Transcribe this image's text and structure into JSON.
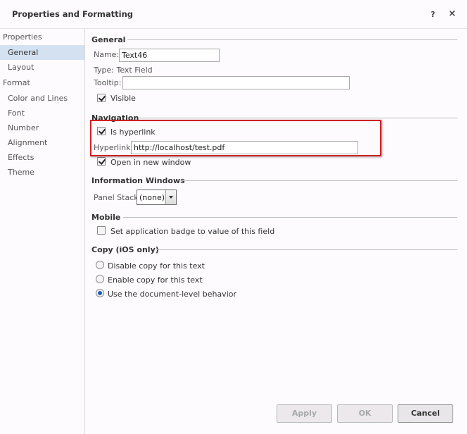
{
  "window": {
    "title": "Properties and Formatting",
    "help_label": "?",
    "close_label": "×"
  },
  "sidebar": {
    "groups": [
      {
        "header": "Properties",
        "items": [
          {
            "label": "General",
            "selected": true
          },
          {
            "label": "Layout",
            "selected": false
          }
        ]
      },
      {
        "header": "Format",
        "items": [
          {
            "label": "Color and Lines",
            "selected": false
          },
          {
            "label": "Font",
            "selected": false
          },
          {
            "label": "Number",
            "selected": false
          },
          {
            "label": "Alignment",
            "selected": false
          },
          {
            "label": "Effects",
            "selected": false
          },
          {
            "label": "Theme",
            "selected": false
          }
        ]
      }
    ]
  },
  "general": {
    "title": "General",
    "name_label": "Name:",
    "name_value": "Text46",
    "type_text": "Type: Text Field",
    "tooltip_label": "Tooltip:",
    "tooltip_value": "",
    "visible_label": "Visible",
    "visible_checked": true
  },
  "navigation": {
    "title": "Navigation",
    "is_hyperlink_label": "Is hyperlink",
    "is_hyperlink_checked": true,
    "hyperlink_label": "Hyperlink:",
    "hyperlink_value": "http://localhost/test.pdf",
    "open_new_window_label": "Open in new window",
    "open_new_window_checked": true
  },
  "information_windows": {
    "title": "Information Windows",
    "panel_stack_label": "Panel Stack:",
    "panel_stack_value": "(none)"
  },
  "mobile": {
    "title": "Mobile",
    "badge_label": "Set application badge to value of this field",
    "badge_checked": false
  },
  "copy_ios": {
    "title": "Copy (iOS only)",
    "options": [
      {
        "label": "Disable copy for this text",
        "selected": false
      },
      {
        "label": "Enable copy for this text",
        "selected": false
      },
      {
        "label": "Use the document-level behavior",
        "selected": true
      }
    ]
  },
  "footer": {
    "apply_label": "Apply",
    "ok_label": "OK",
    "cancel_label": "Cancel"
  },
  "colors": {
    "selection_bg": "#d4e1f0",
    "highlight_border": "#cc2222",
    "radio_dot": "#1b5fb8"
  }
}
